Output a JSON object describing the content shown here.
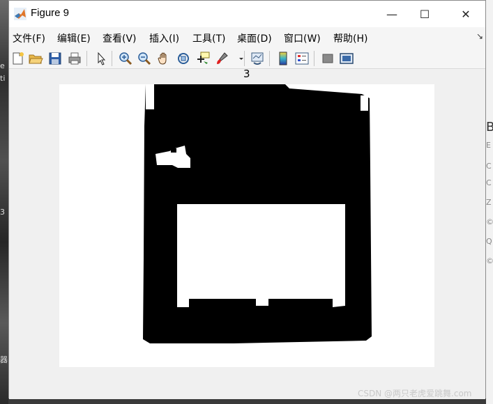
{
  "window": {
    "title": "Figure 9",
    "controls": {
      "minimize": "—",
      "maximize": "☐",
      "close": "✕"
    }
  },
  "menubar": {
    "items": [
      {
        "id": "file",
        "label": "文件(F)"
      },
      {
        "id": "edit",
        "label": "编辑(E)"
      },
      {
        "id": "view",
        "label": "查看(V)"
      },
      {
        "id": "insert",
        "label": "插入(I)"
      },
      {
        "id": "tools",
        "label": "工具(T)"
      },
      {
        "id": "desktop",
        "label": "桌面(D)"
      },
      {
        "id": "window",
        "label": "窗口(W)"
      },
      {
        "id": "help",
        "label": "帮助(H)"
      }
    ],
    "dock_arrow": "↘"
  },
  "toolbar": {
    "buttons": [
      "new-figure",
      "open-file",
      "save",
      "print",
      "edit-plot",
      "zoom-in",
      "zoom-out",
      "pan",
      "rotate-3d",
      "data-cursor",
      "brush",
      "link-plot",
      "insert-colorbar",
      "insert-legend",
      "hide-plot-tools",
      "show-plot-tools"
    ]
  },
  "axes": {
    "title": "3"
  },
  "watermark": "CSDN @两只老虎爱跳舞.com",
  "colors": {
    "figure_bg": "#f0f0f0",
    "image_fg": "#000000",
    "image_bg": "#ffffff"
  }
}
